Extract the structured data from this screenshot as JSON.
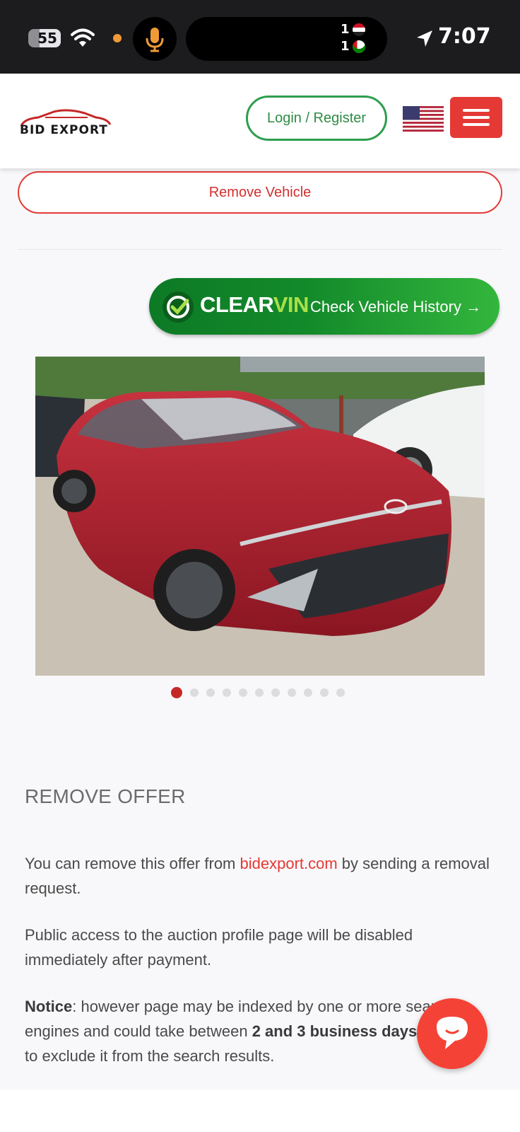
{
  "status_bar": {
    "battery_level": "55",
    "time": "7:07",
    "notif_counts": [
      "1",
      "1"
    ],
    "colors": {
      "recording_dot": "#f09a37",
      "mic": "#f09a37"
    }
  },
  "header": {
    "logo_text_1": "BID",
    "logo_text_2": "EXPORT",
    "login_label": "Login / Register",
    "flag_icon": "us-flag-icon",
    "menu_icon": "hamburger-menu-icon",
    "colors": {
      "login_border": "#2e9e4e",
      "menu_bg": "#e53935"
    }
  },
  "vehicle": {
    "remove_label": "Remove Vehicle",
    "clearvin": {
      "brand_clear": "CLEAR",
      "brand_vin": "VIN",
      "tagline": "Check Vehicle History →"
    },
    "gallery": {
      "image_alt": "Red Hyundai Sonata",
      "total_slides": 11,
      "active_index": 0
    }
  },
  "remove_offer": {
    "title": "REMOVE OFFER",
    "p1_before": "You can remove this offer from ",
    "p1_link": "bidexport.com",
    "p1_after": " by sending a removal request.",
    "p2": "Public access to the auction profile page will be disabled immediately after payment.",
    "p3_label": "Notice",
    "p3_a": ": however page may be indexed by one or more search engines and could take between ",
    "p3_bold": "2 and 3 business days",
    "p3_b": " in order to exclude it from the search results."
  },
  "chat": {
    "icon": "chat-bubble-icon",
    "color": "#f44336"
  }
}
